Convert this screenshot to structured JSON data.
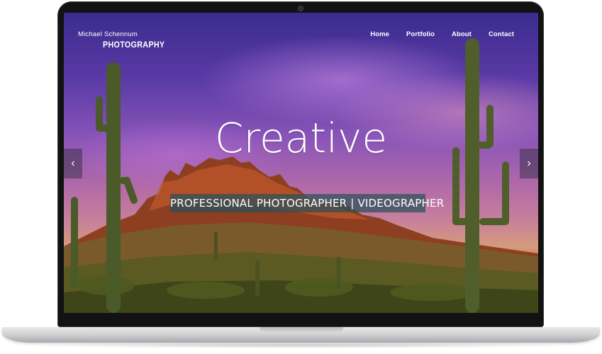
{
  "site": {
    "brand_name": "Michael Schennum",
    "brand_sub": "PHOTOGRAPHY"
  },
  "nav": {
    "items": [
      "Home",
      "Portfolio",
      "About",
      "Contact"
    ]
  },
  "hero": {
    "title": "Creative",
    "subtitle": "PROFESSIONAL PHOTOGRAPHER | VIDEOGRAPHER"
  },
  "slider": {
    "prev_icon": "chevron-left-icon",
    "next_icon": "chevron-right-icon",
    "prev_glyph": "‹",
    "next_glyph": "›"
  },
  "colors": {
    "sky_top": "#3b2c8e",
    "sky_mid": "#8a55b8",
    "horizon": "#d59a7a",
    "banner": "#28505a"
  }
}
